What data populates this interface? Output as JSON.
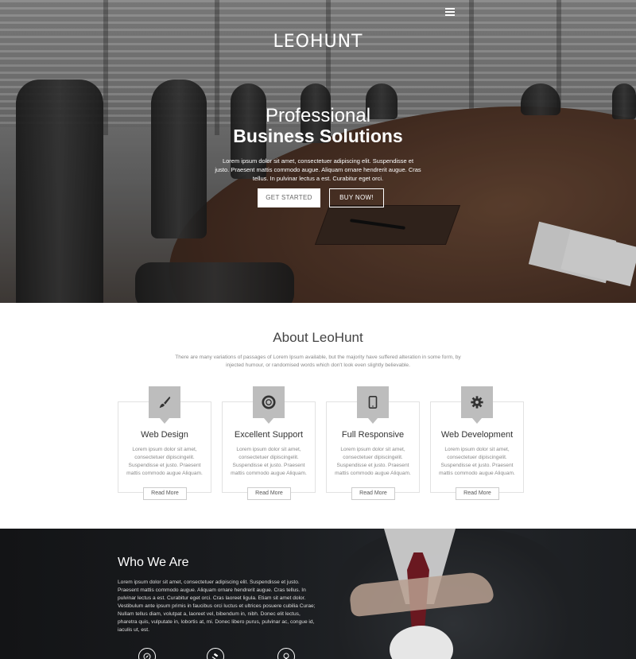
{
  "header": {
    "logo": "LEOHUNT",
    "menu_icon": "hamburger-menu-icon"
  },
  "hero": {
    "subtitle": "Professional",
    "title": "Business Solutions",
    "text": "Lorem ipsum dolor sit amet, consectetuer adipiscing elit. Suspendisse et justo. Praesent mattis commodo augue. Aliquam ornare hendrerit augue. Cras tellus. In pulvinar lectus a est. Curabitur eget orci.",
    "buttons": {
      "get_started": "GET STARTED",
      "buy_now": "BUY NOW!"
    }
  },
  "about": {
    "title": "About LeoHunt",
    "text": "There are many variations of passages of Lorem Ipsum available, but the majority have suffered alteration in some form, by injected humour, or randomised words which don't look even slightly believable.",
    "cards": [
      {
        "title": "Web Design",
        "icon": "paint-brush-icon",
        "text": "Lorem ipsum dolor sit amet, consectetuer dipiscingelit. Suspendisse et justo. Praesent mattis commodo augue Aliquam.",
        "button": "Read More"
      },
      {
        "title": "Excellent Support",
        "icon": "life-ring-icon",
        "text": "Lorem ipsum dolor sit amet, consectetuer dipiscingelit. Suspendisse et justo. Praesent mattis commodo augue Aliquam.",
        "button": "Read More"
      },
      {
        "title": "Full Responsive",
        "icon": "tablet-icon",
        "text": "Lorem ipsum dolor sit amet, consectetuer dipiscingelit. Suspendisse et justo. Praesent mattis commodo augue Aliquam.",
        "button": "Read More"
      },
      {
        "title": "Web Development",
        "icon": "gear-icon",
        "text": "Lorem ipsum dolor sit amet, consectetuer dipiscingelit. Suspendisse et justo. Praesent mattis commodo augue Aliquam.",
        "button": "Read More"
      }
    ]
  },
  "who": {
    "title": "Who We Are",
    "text": "Lorem ipsum dolor sit amet, consectetuer adipiscing elit. Suspendisse et justo. Praesent mattis commodo augue. Aliquam ornare hendrerit augue. Cras tellus. In pulvinar lectus a est. Curabitur eget orci. Cras laoreet ligula. Etiam sit amet dolor. Vestibulum ante ipsum primis in faucibus orci luctus et ultrices posuere cubilia Curae; Nullam tellus diam, volutpat a, laoreet vel, bibendum in, nibh. Donec elit lectus, pharetra quis, vulputate in, lobortis at, mi. Donec libero purus, pulvinar ac, congue id, iaculis ut, est.",
    "icons": [
      "compass-icon",
      "gavel-icon",
      "lightbulb-icon"
    ]
  },
  "colors": {
    "card_icon_bg": "#bdbdbd",
    "dark_section": "#1a1c1f",
    "tie": "#6a1820"
  }
}
